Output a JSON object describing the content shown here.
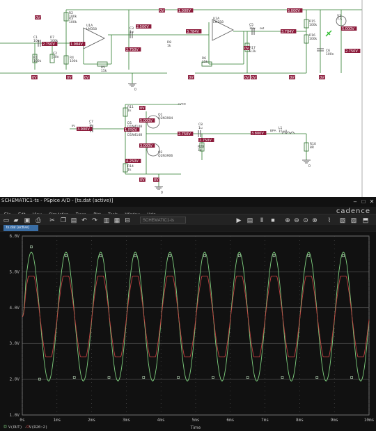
{
  "schematic": {
    "voltage_labels": [
      "1.000V",
      "5.000V",
      "5.000V",
      "0V",
      "0V",
      "2.750V",
      "1.984V",
      "2.500V",
      "2.750V",
      "3.784V",
      "3.784V",
      "0V",
      "2.750V",
      "0V",
      "0V",
      "0V",
      "0V",
      "5.000V",
      "3.000V",
      "4.250V",
      "2.750V",
      "1.050V",
      "3.900V",
      "0V",
      "0V",
      "2.750V",
      "3.800V",
      "0V",
      "0V",
      "0V",
      "0V",
      "0V"
    ],
    "parts": [
      {
        "ref": "R2",
        "value": "100k"
      },
      {
        "ref": "R3",
        "value": "100k"
      },
      {
        "ref": "C1",
        "value": "10u"
      },
      {
        "ref": "R1",
        "value": "100k"
      },
      {
        "ref": "R7",
        "value": "100k"
      },
      {
        "ref": "C2",
        "value": "10n"
      },
      {
        "ref": "R4",
        "value": "100k"
      },
      {
        "ref": "U1A",
        "value": "LM358"
      },
      {
        "ref": "R5",
        "value": "15k"
      },
      {
        "ref": "C3",
        "value": "1u"
      },
      {
        "ref": "R8",
        "value": "1k"
      },
      {
        "ref": "U2A",
        "value": "LM358"
      },
      {
        "ref": "R6",
        "value": "15k"
      },
      {
        "ref": "C5",
        "value": "10u"
      },
      {
        "ref": "R17",
        "value": "8.2k"
      },
      {
        "ref": "R15",
        "value": "100k"
      },
      {
        "ref": "R16",
        "value": "100k"
      },
      {
        "ref": "C6",
        "value": "100n"
      },
      {
        "ref": "V1",
        "value": "7.5"
      },
      {
        "ref": "R11",
        "value": "1k"
      },
      {
        "ref": "D1",
        "value": "D1N4148"
      },
      {
        "ref": "D2",
        "value": "D1N4148"
      },
      {
        "ref": "Q1",
        "value": "Q2N3904"
      },
      {
        "ref": "Q2",
        "value": "Q2N3906"
      },
      {
        "ref": "C7",
        "value": "1u"
      },
      {
        "ref": "R14",
        "value": "1k"
      },
      {
        "ref": "C8",
        "value": "1u"
      },
      {
        "ref": "R20",
        "value": "1k"
      },
      {
        "ref": "L1",
        "value": "15uH"
      },
      {
        "ref": "R10",
        "value": "8R"
      }
    ],
    "grounds": [
      "0",
      "0",
      "0"
    ],
    "net_labels": [
      "out",
      "+VCC",
      "IN",
      "BPA"
    ]
  },
  "window": {
    "title": "SCHEMATIC1-ts - PSpice A/D - [ts.dat (active)]",
    "menu": [
      "File",
      "Edit",
      "View",
      "Simulation",
      "Trace",
      "Plot",
      "Tools",
      "Window",
      "Help"
    ],
    "brand": "cadence",
    "profile_combo": "SCHEMATIC1-ts",
    "tab_label": "ts.dat (active)",
    "toolbar_icons": [
      "new-icon",
      "open-icon",
      "save-icon",
      "print-icon",
      "cut-icon",
      "copy-icon",
      "paste-icon",
      "undo-icon",
      "redo-icon",
      "run-icon",
      "pause-icon",
      "stop-icon",
      "zoom-in-icon",
      "zoom-out-icon",
      "zoom-area-icon",
      "zoom-fit-icon",
      "add-trace-icon",
      "markers-icon"
    ]
  },
  "chart_data": {
    "type": "line",
    "xlabel": "Time",
    "ylim": [
      1.0,
      6.0
    ],
    "xlim": [
      0,
      10
    ],
    "y_ticks": [
      "1.0V",
      "2.0V",
      "3.0V",
      "4.0V",
      "5.0V",
      "6.0V"
    ],
    "x_ticks": [
      "0s",
      "1ms",
      "2ms",
      "3ms",
      "4ms",
      "5ms",
      "6ms",
      "7ms",
      "8ms",
      "9ms",
      "10ms"
    ],
    "grid": true,
    "legend": [
      {
        "name": "V(OUT)",
        "color": "#7fd07f",
        "marker": "square"
      },
      {
        "name": "V(R20:2)",
        "color": "#c04040",
        "marker": "circle"
      }
    ],
    "legend_text": "V(OUT) - V(R20:2)",
    "series": [
      {
        "name": "V(OUT)",
        "color": "#7fd07f",
        "waveform": "sine",
        "period_ms": 1.0,
        "offset": 3.75,
        "amplitude": 1.8,
        "phase_ms_of_first_peak": 0.26,
        "start_value": 3.75
      },
      {
        "name": "V(R20:2)",
        "color": "#c04040",
        "waveform": "clipped-sine",
        "period_ms": 1.0,
        "offset": 3.75,
        "amplitude": 1.3,
        "clip_high": 4.88,
        "clip_low": 2.62,
        "phase_ms_of_first_peak": 0.26
      }
    ],
    "marker_points": [
      {
        "x": 0.5,
        "y": 2.0
      },
      {
        "x": 1.5,
        "y": 2.05
      },
      {
        "x": 2.5,
        "y": 2.05
      },
      {
        "x": 3.5,
        "y": 2.05
      },
      {
        "x": 4.5,
        "y": 2.05
      },
      {
        "x": 5.5,
        "y": 2.05
      },
      {
        "x": 6.5,
        "y": 2.05
      },
      {
        "x": 7.5,
        "y": 2.05
      },
      {
        "x": 8.5,
        "y": 2.05
      },
      {
        "x": 9.5,
        "y": 2.05
      },
      {
        "x": 0.26,
        "y": 5.7
      },
      {
        "x": 1.26,
        "y": 5.45
      },
      {
        "x": 2.26,
        "y": 5.45
      },
      {
        "x": 3.26,
        "y": 5.45
      },
      {
        "x": 4.26,
        "y": 5.45
      },
      {
        "x": 5.26,
        "y": 5.45
      },
      {
        "x": 6.26,
        "y": 5.45
      },
      {
        "x": 7.26,
        "y": 5.45
      },
      {
        "x": 8.26,
        "y": 5.45
      },
      {
        "x": 9.26,
        "y": 5.45
      }
    ]
  }
}
